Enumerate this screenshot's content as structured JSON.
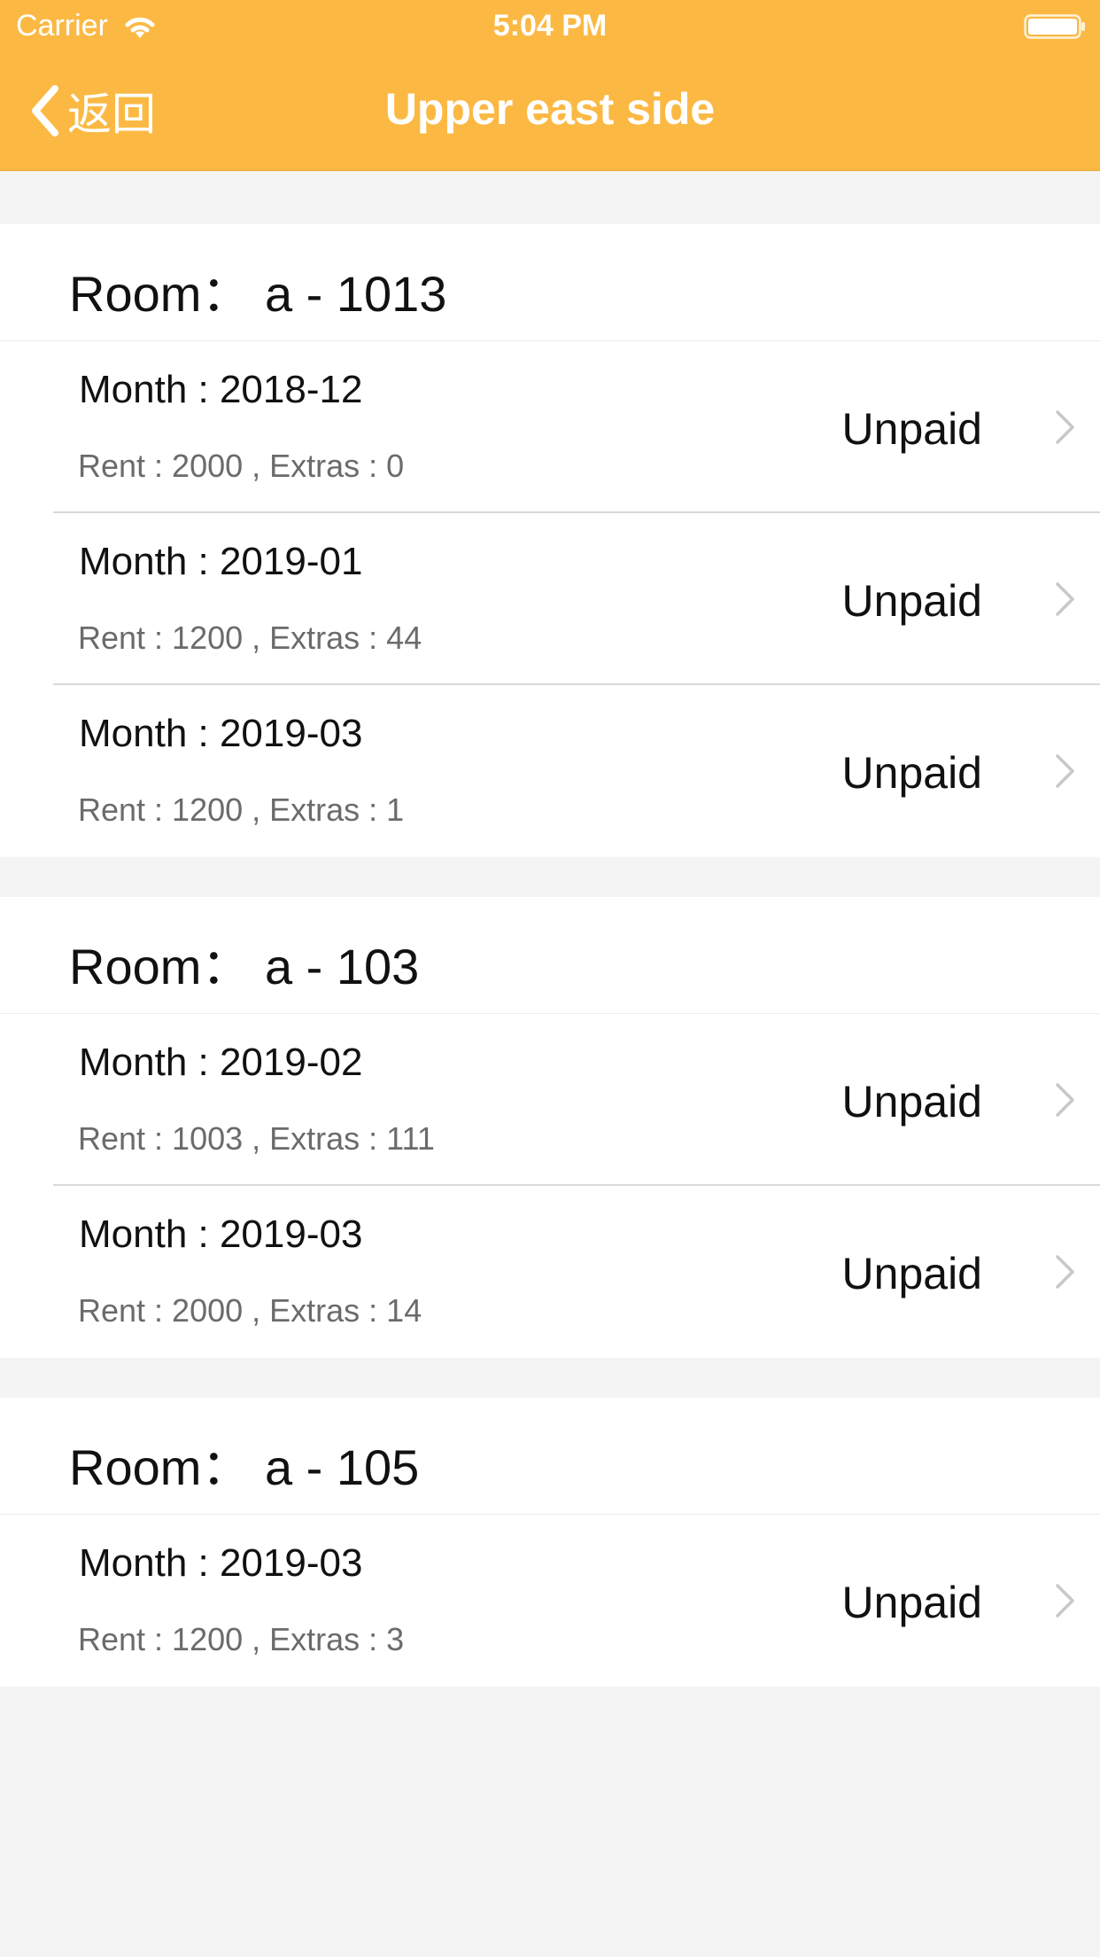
{
  "status_bar": {
    "carrier": "Carrier",
    "time": "5:04 PM",
    "icons": [
      "wifi-icon",
      "battery-icon"
    ]
  },
  "nav": {
    "back_label": "返回",
    "title": "Upper east side",
    "accent_color": "#fbb944"
  },
  "rooms": [
    {
      "title": "Room： a - 1013",
      "rows": [
        {
          "month": "Month : 2018-12",
          "detail": "Rent : 2000 ,  Extras : 0",
          "status": "Unpaid"
        },
        {
          "month": "Month : 2019-01",
          "detail": "Rent : 1200 ,  Extras : 44",
          "status": "Unpaid"
        },
        {
          "month": "Month : 2019-03",
          "detail": "Rent : 1200 ,  Extras : 1",
          "status": "Unpaid"
        }
      ]
    },
    {
      "title": "Room： a - 103",
      "rows": [
        {
          "month": "Month : 2019-02",
          "detail": "Rent : 1003 ,  Extras : 111",
          "status": "Unpaid"
        },
        {
          "month": "Month : 2019-03",
          "detail": "Rent : 2000 ,  Extras : 14",
          "status": "Unpaid"
        }
      ]
    },
    {
      "title": "Room： a - 105",
      "rows": [
        {
          "month": "Month : 2019-03",
          "detail": "Rent : 1200 ,  Extras : 3",
          "status": "Unpaid"
        }
      ]
    }
  ]
}
